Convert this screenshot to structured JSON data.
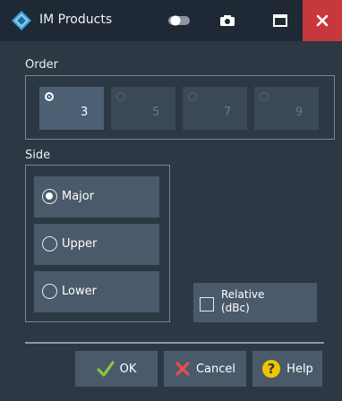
{
  "window": {
    "title": "IM Products",
    "controls": {
      "toggle_icon": "toggle-icon",
      "camera_icon": "camera-icon",
      "maximize_icon": "maximize-icon",
      "close_icon": "close-icon"
    }
  },
  "order": {
    "label": "Order",
    "options": [
      {
        "label": "3",
        "selected": true
      },
      {
        "label": "5",
        "selected": false
      },
      {
        "label": "7",
        "selected": false
      },
      {
        "label": "9",
        "selected": false
      }
    ]
  },
  "side": {
    "label": "Side",
    "options": [
      {
        "label": "Major",
        "selected": true
      },
      {
        "label": "Upper",
        "selected": false
      },
      {
        "label": "Lower",
        "selected": false
      }
    ]
  },
  "relative": {
    "label_line1": "Relative",
    "label_line2": "(dBc)",
    "checked": false
  },
  "footer": {
    "ok_label": "OK",
    "cancel_label": "Cancel",
    "help_label": "Help"
  },
  "colors": {
    "background": "#2d3845",
    "titlebar": "#1e2935",
    "close": "#c7383d",
    "button": "#4a5a6b",
    "ok_check": "#8cc63f",
    "cancel_x": "#e84d4d",
    "help_circle": "#f2c400"
  }
}
